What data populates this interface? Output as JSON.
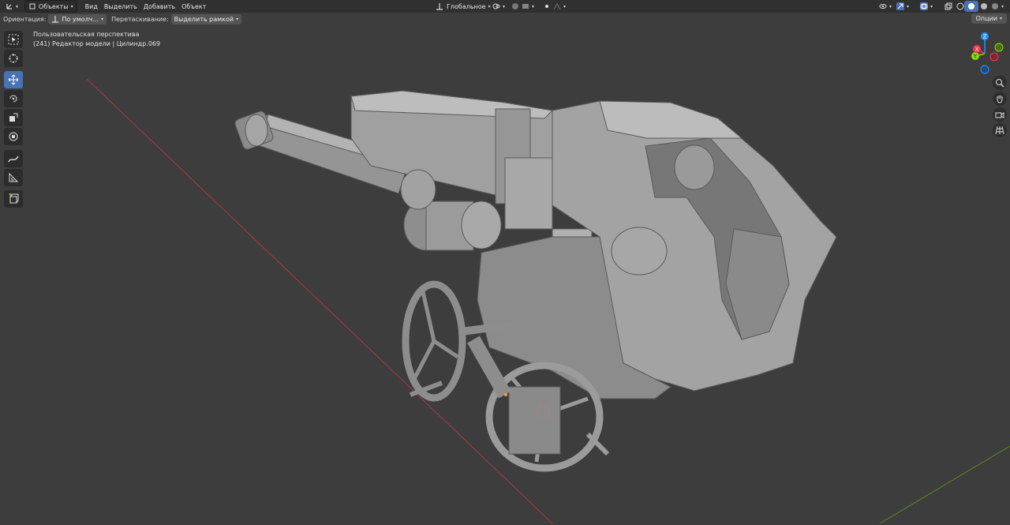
{
  "header": {
    "editor_type_icon": "axis-editor-icon",
    "mode": "Объекты",
    "menus": [
      "Вид",
      "Выделить",
      "Добавить",
      "Объект"
    ],
    "transform_orientation": "Глобальное",
    "pivot_icon": "pivot-point-icon",
    "snap_icon": "snap-icon",
    "proportional_icon": "proportional-editing-icon",
    "right_icons": [
      "visibility-icon",
      "gizmo-icon",
      "overlay-icon",
      "xray-icon",
      "solid-shading-icon",
      "material-shading-icon",
      "rendered-shading-icon"
    ]
  },
  "tool_settings": {
    "orientation_label": "Ориентация:",
    "orientation_value": "По умолч...",
    "drag_label": "Перетаскивание:",
    "drag_value": "Выделить рамкой",
    "options": "Опции"
  },
  "left_tools": [
    "select-box-icon",
    "cursor-icon",
    "move-icon",
    "rotate-icon",
    "scale-icon",
    "transform-icon",
    "annotate-icon",
    "measure-icon",
    "add-cube-icon"
  ],
  "viewport": {
    "view_name": "Пользовательская перспектива",
    "object_info": "(241) Редактор модели | Цилиндр.069"
  },
  "gizmo": {
    "x_label": "X",
    "y_label": "Y",
    "z_label": "Z",
    "colors": {
      "x": "#ff3352",
      "y": "#8bdc00",
      "z": "#2890ff"
    },
    "buttons": [
      "zoom-icon",
      "pan-hand-icon",
      "camera-icon",
      "perspective-grid-icon"
    ]
  },
  "colors": {
    "bg": "#3d3d3d",
    "header": "#303030",
    "accent": "#4772b3",
    "model": "#9a9a9a"
  }
}
